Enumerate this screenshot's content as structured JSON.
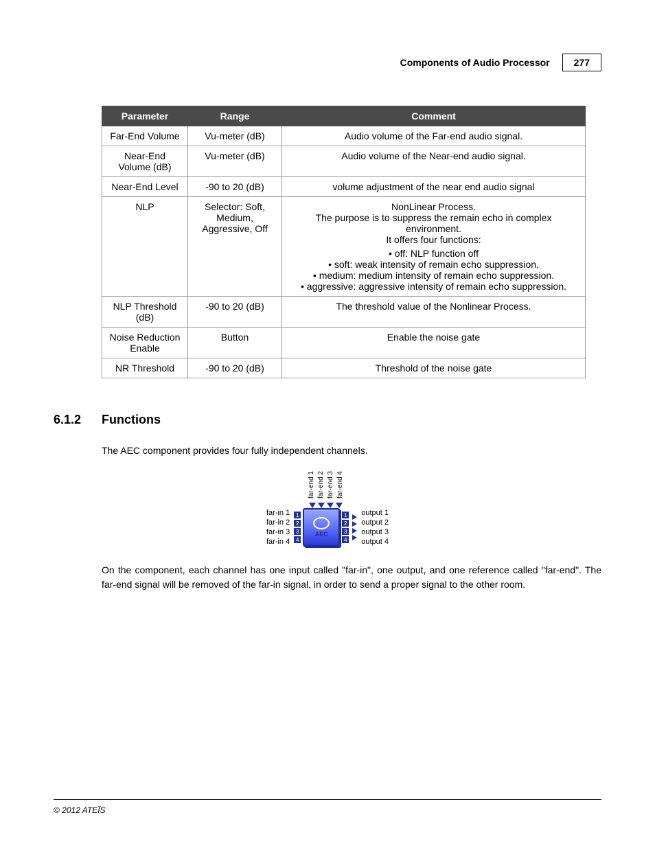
{
  "header": {
    "title": "Components of Audio Processor",
    "page_number": "277"
  },
  "table": {
    "columns": [
      "Parameter",
      "Range",
      "Comment"
    ],
    "rows": [
      {
        "parameter": "Far-End Volume",
        "range": "Vu-meter (dB)",
        "comment": "Audio volume of the Far-end audio signal."
      },
      {
        "parameter": "Near-End Volume (dB)",
        "range": "Vu-meter (dB)",
        "comment": "Audio volume of the Near-end audio signal."
      },
      {
        "parameter": "Near-End Level",
        "range": "-90 to 20 (dB)",
        "comment": "volume adjustment of the near end audio signal"
      },
      {
        "parameter": "NLP",
        "range": "Selector: Soft, Medium, Aggressive, Off",
        "comment_intro": "NonLinear Process.\nThe purpose is to suppress the remain echo in complex environment.\nIt offers four functions:",
        "comment_items": [
          "off: NLP function off",
          "soft: weak intensity of remain echo suppression.",
          "medium: medium intensity of remain echo suppression.",
          "aggressive: aggressive intensity of remain echo suppression."
        ]
      },
      {
        "parameter": "NLP Threshold (dB)",
        "range": "-90 to 20 (dB)",
        "comment": "The threshold value of the Nonlinear Process."
      },
      {
        "parameter": "Noise Reduction Enable",
        "range": "Button",
        "comment": "Enable the noise gate"
      },
      {
        "parameter": "NR Threshold",
        "range": "-90 to 20 (dB)",
        "comment": "Threshold of the noise gate"
      }
    ]
  },
  "section": {
    "number": "6.1.2",
    "title": "Functions",
    "para1": "The AEC component provides four fully independent channels.",
    "para2": "On the component, each channel has one input called \"far-in\", one output, and one reference called \"far-end\". The far-end signal will be removed of the far-in signal, in order to send a proper signal to the other room."
  },
  "diagram": {
    "top": [
      "far-end 1",
      "far-end 2",
      "far-end 3",
      "far-end 4"
    ],
    "left": [
      "far-in 1",
      "far-in 2",
      "far-in 3",
      "far-in 4"
    ],
    "right": [
      "output 1",
      "output 2",
      "output 3",
      "output 4"
    ],
    "box_label": "AEC"
  },
  "footer": {
    "copyright": "© 2012 ATEÏS"
  }
}
